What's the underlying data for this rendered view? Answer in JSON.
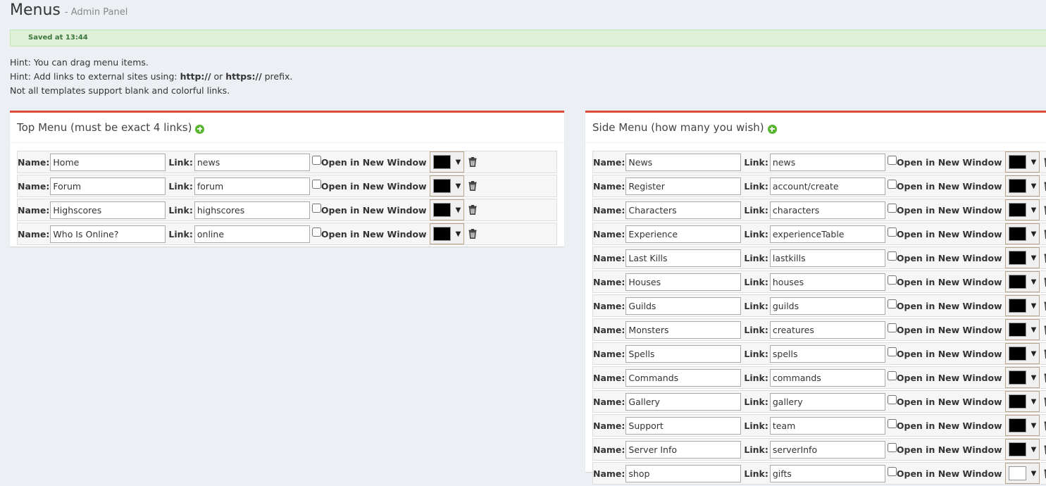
{
  "page": {
    "title": "Menus",
    "subtitle": "- Admin Panel"
  },
  "alert": {
    "text": "Saved at 13:44",
    "color": "#3c763d"
  },
  "hints": {
    "line1": "Hint: You can drag menu items.",
    "line2_prefix": "Hint: Add links to external sites using: ",
    "line2_http": "http://",
    "line2_or": " or ",
    "line2_https": "https://",
    "line2_suffix": " prefix.",
    "line3": "Not all templates support blank and colorful links."
  },
  "labels": {
    "name": "Name:",
    "link": "Link:",
    "new_window": "Open in New Window"
  },
  "colors": {
    "accent": "#dd4b39",
    "add": "#57b52f"
  },
  "top_menu": {
    "title": "Top Menu (must be exact 4 links)",
    "items": [
      {
        "name": "Home",
        "link": "news",
        "new_window": false,
        "color": "#000000"
      },
      {
        "name": "Forum",
        "link": "forum",
        "new_window": false,
        "color": "#000000"
      },
      {
        "name": "Highscores",
        "link": "highscores",
        "new_window": false,
        "color": "#000000"
      },
      {
        "name": "Who Is Online?",
        "link": "online",
        "new_window": false,
        "color": "#000000"
      }
    ]
  },
  "side_menu": {
    "title": "Side Menu (how many you wish)",
    "items": [
      {
        "name": "News",
        "link": "news",
        "new_window": false,
        "color": "#000000"
      },
      {
        "name": "Register",
        "link": "account/create",
        "new_window": false,
        "color": "#000000"
      },
      {
        "name": "Characters",
        "link": "characters",
        "new_window": false,
        "color": "#000000"
      },
      {
        "name": "Experience",
        "link": "experienceTable",
        "new_window": false,
        "color": "#000000"
      },
      {
        "name": "Last Kills",
        "link": "lastkills",
        "new_window": false,
        "color": "#000000"
      },
      {
        "name": "Houses",
        "link": "houses",
        "new_window": false,
        "color": "#000000"
      },
      {
        "name": "Guilds",
        "link": "guilds",
        "new_window": false,
        "color": "#000000"
      },
      {
        "name": "Monsters",
        "link": "creatures",
        "new_window": false,
        "color": "#000000"
      },
      {
        "name": "Spells",
        "link": "spells",
        "new_window": false,
        "color": "#000000"
      },
      {
        "name": "Commands",
        "link": "commands",
        "new_window": false,
        "color": "#000000"
      },
      {
        "name": "Gallery",
        "link": "gallery",
        "new_window": false,
        "color": "#000000"
      },
      {
        "name": "Support",
        "link": "team",
        "new_window": false,
        "color": "#000000"
      },
      {
        "name": "Server Info",
        "link": "serverInfo",
        "new_window": false,
        "color": "#000000"
      },
      {
        "name": "shop",
        "link": "gifts",
        "new_window": false,
        "color": "#ffffff"
      }
    ]
  }
}
